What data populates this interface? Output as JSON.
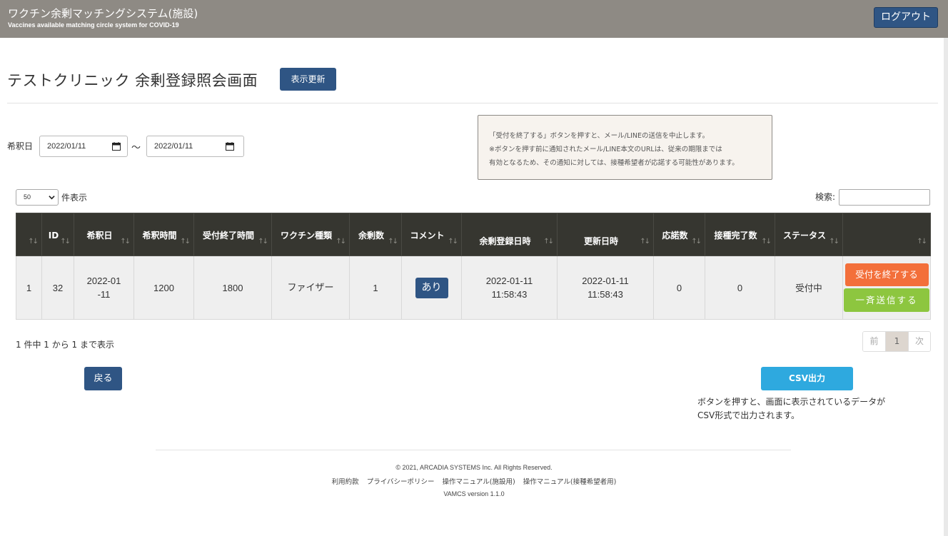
{
  "header": {
    "title": "ワクチン余剰マッチングシステム(施設)",
    "subtitle": "Vaccines available matching circle system for COVID-19",
    "logout_label": "ログアウト"
  },
  "page": {
    "title": "テストクリニック 余剰登録照会画面",
    "refresh_label": "表示更新"
  },
  "notice": {
    "line1": "「受付を終了する」ボタンを押すと、メール/LINEの送信を中止します。",
    "line2": "※ボタンを押す前に通知されたメール/LINE本文のURLは、従来の期限までは",
    "line3": "有効となるため、その通知に対しては、接種希望者が応諾する可能性があります。"
  },
  "filter": {
    "date_label": "希釈日",
    "date_from": "2022/01/11",
    "date_to": "2022/01/11",
    "separator": "～"
  },
  "list_controls": {
    "per_page_value": "50",
    "per_page_label": "件表示",
    "search_label": "検索:",
    "search_value": ""
  },
  "table": {
    "headers": [
      {
        "label": ""
      },
      {
        "label": "ID"
      },
      {
        "label": "希釈日"
      },
      {
        "label": "希釈時間"
      },
      {
        "label": "受付終了時間"
      },
      {
        "label": "ワクチン種類"
      },
      {
        "label": "余剰数"
      },
      {
        "label": "コメント"
      },
      {
        "label": "余剰登録日時"
      },
      {
        "label": "更新日時"
      },
      {
        "label": "応諾数"
      },
      {
        "label": "接種完了数"
      },
      {
        "label": "ステータス"
      },
      {
        "label": ""
      }
    ],
    "sort_glyph": "↑↓",
    "rows": [
      {
        "no": "1",
        "id": "32",
        "dilution_date": "2022-01-11",
        "dilution_time": "1200",
        "accept_end_time": "1800",
        "vaccine_type": "ファイザー",
        "surplus": "1",
        "comment_label": "あり",
        "registered_date": "2022-01-11",
        "registered_time": "11:58:43",
        "updated_date": "2022-01-11",
        "updated_time": "11:58:43",
        "accepted": "0",
        "completed": "0",
        "status": "受付中",
        "end_button": "受付を終了する",
        "send_button": "一斉送信する"
      }
    ]
  },
  "summary": "1 件中 1 から 1 まで表示",
  "pager": {
    "prev": "前",
    "current": "1",
    "next": "次"
  },
  "actions": {
    "back_label": "戻る",
    "csv_label": "CSV出力",
    "csv_note_line1": "ボタンを押すと、画面に表示されているデータが",
    "csv_note_line2": "CSV形式で出力されます。"
  },
  "footer": {
    "copyright": "© 2021, ARCADIA SYSTEMS Inc. All Rights Reserved.",
    "links": [
      "利用約款",
      "プライバシーポリシー",
      "操作マニュアル(施設用)",
      "操作マニュアル(接種希望者用)"
    ],
    "version": "VAMCS version 1.1.0"
  },
  "colors": {
    "header_bg": "#8e8a84",
    "primary": "#2f5584",
    "end_button": "#f36f3a",
    "send_button": "#8dc63f",
    "csv_button": "#2ea9df",
    "table_header": "#363630"
  }
}
